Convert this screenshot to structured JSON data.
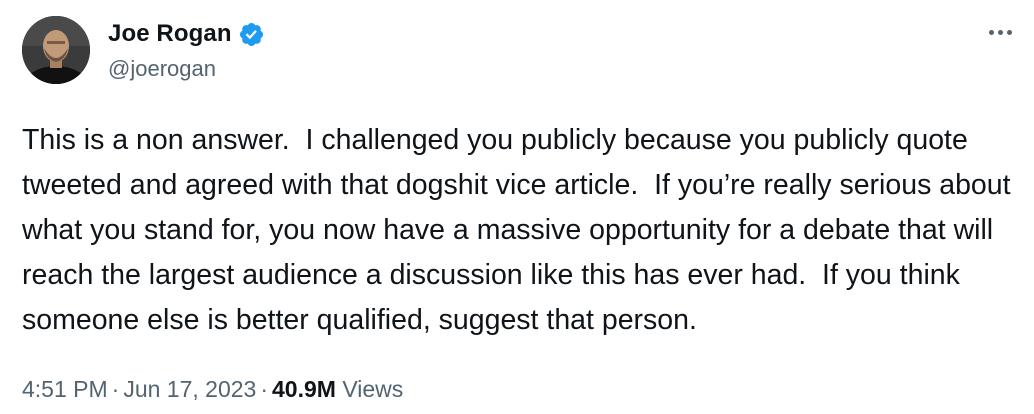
{
  "tweet": {
    "author": {
      "display_name": "Joe Rogan",
      "handle": "@joerogan",
      "verified": true,
      "avatar_icon": "profile-photo"
    },
    "more_icon": "more-options-icon",
    "text": "This is a non answer.  I challenged you publicly because you publicly quote tweeted and agreed with that dogshit vice article.  If you’re really serious about what you stand for, you now have a massive opportunity for a debate that will reach the largest audience a discussion like this has ever had.  If you think someone else is better qualified, suggest that person.",
    "time": "4:51 PM",
    "separator": "·",
    "date": "Jun 17, 2023",
    "views_count": "40.9M",
    "views_label": "Views"
  },
  "colors": {
    "verified_badge": "#1d9bf0",
    "secondary_text": "#536471",
    "primary_text": "#0f1419"
  }
}
